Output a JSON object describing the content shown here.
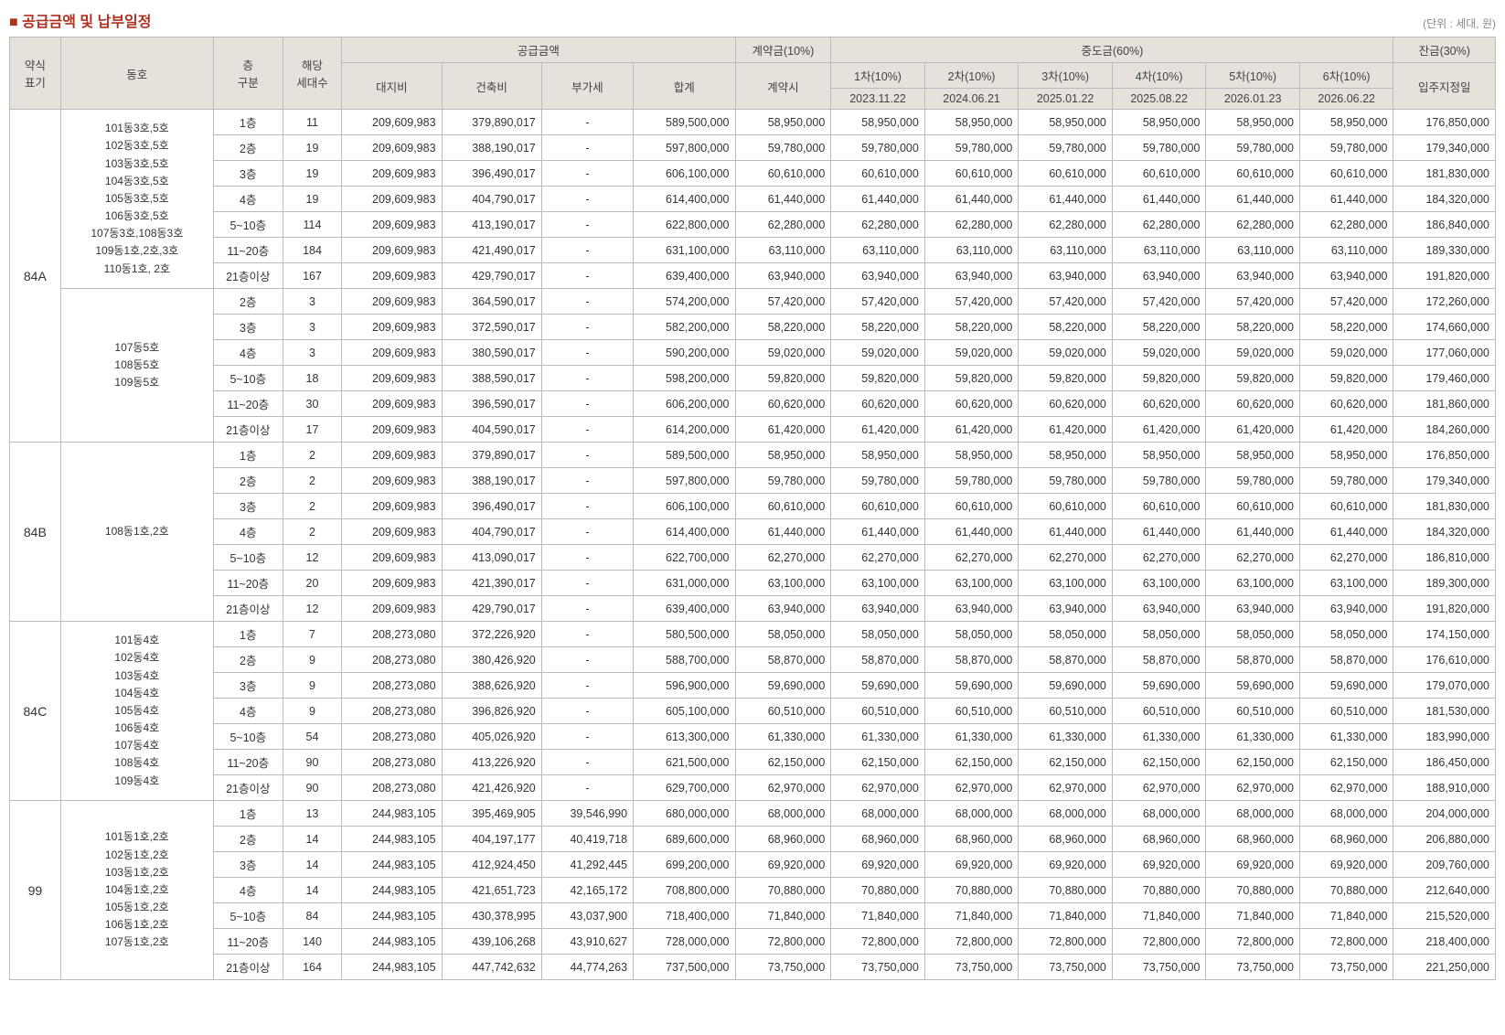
{
  "title": "공급금액 및 납부일정",
  "unit": "(단위 : 세대, 원)",
  "headers": {
    "type": "약식\n표기",
    "dongho": "동호",
    "floor": "층\n구분",
    "count": "해당\n세대수",
    "supply_group": "공급금액",
    "land": "대지비",
    "build": "건축비",
    "tax": "부가세",
    "sum": "합계",
    "deposit_group": "계약금(10%)",
    "deposit": "계약시",
    "mid_group": "중도금(60%)",
    "mid1": "1차(10%)",
    "mid1_date": "2023.11.22",
    "mid2": "2차(10%)",
    "mid2_date": "2024.06.21",
    "mid3": "3차(10%)",
    "mid3_date": "2025.01.22",
    "mid4": "4차(10%)",
    "mid4_date": "2025.08.22",
    "mid5": "5차(10%)",
    "mid5_date": "2026.01.23",
    "mid6": "6차(10%)",
    "mid6_date": "2026.06.22",
    "balance_group": "잔금(30%)",
    "balance": "입주지정일"
  },
  "groups": [
    {
      "type": "84A",
      "blocks": [
        {
          "dongho": "101동3호,5호\n102동3호,5호\n103동3호,5호\n104동3호,5호\n105동3호,5호\n106동3호,5호\n107동3호,108동3호\n109동1호,2호,3호\n110동1호, 2호",
          "rows": [
            {
              "floor": "1층",
              "count": "11",
              "land": "209,609,983",
              "build": "379,890,017",
              "tax": "-",
              "sum": "589,500,000",
              "dep": "58,950,000",
              "mid": "58,950,000",
              "bal": "176,850,000"
            },
            {
              "floor": "2층",
              "count": "19",
              "land": "209,609,983",
              "build": "388,190,017",
              "tax": "-",
              "sum": "597,800,000",
              "dep": "59,780,000",
              "mid": "59,780,000",
              "bal": "179,340,000"
            },
            {
              "floor": "3층",
              "count": "19",
              "land": "209,609,983",
              "build": "396,490,017",
              "tax": "-",
              "sum": "606,100,000",
              "dep": "60,610,000",
              "mid": "60,610,000",
              "bal": "181,830,000"
            },
            {
              "floor": "4층",
              "count": "19",
              "land": "209,609,983",
              "build": "404,790,017",
              "tax": "-",
              "sum": "614,400,000",
              "dep": "61,440,000",
              "mid": "61,440,000",
              "bal": "184,320,000"
            },
            {
              "floor": "5~10층",
              "count": "114",
              "land": "209,609,983",
              "build": "413,190,017",
              "tax": "-",
              "sum": "622,800,000",
              "dep": "62,280,000",
              "mid": "62,280,000",
              "bal": "186,840,000"
            },
            {
              "floor": "11~20층",
              "count": "184",
              "land": "209,609,983",
              "build": "421,490,017",
              "tax": "-",
              "sum": "631,100,000",
              "dep": "63,110,000",
              "mid": "63,110,000",
              "bal": "189,330,000"
            },
            {
              "floor": "21층이상",
              "count": "167",
              "land": "209,609,983",
              "build": "429,790,017",
              "tax": "-",
              "sum": "639,400,000",
              "dep": "63,940,000",
              "mid": "63,940,000",
              "bal": "191,820,000"
            }
          ]
        },
        {
          "dongho": "107동5호\n108동5호\n109동5호",
          "rows": [
            {
              "floor": "2층",
              "count": "3",
              "land": "209,609,983",
              "build": "364,590,017",
              "tax": "-",
              "sum": "574,200,000",
              "dep": "57,420,000",
              "mid": "57,420,000",
              "bal": "172,260,000"
            },
            {
              "floor": "3층",
              "count": "3",
              "land": "209,609,983",
              "build": "372,590,017",
              "tax": "-",
              "sum": "582,200,000",
              "dep": "58,220,000",
              "mid": "58,220,000",
              "bal": "174,660,000"
            },
            {
              "floor": "4층",
              "count": "3",
              "land": "209,609,983",
              "build": "380,590,017",
              "tax": "-",
              "sum": "590,200,000",
              "dep": "59,020,000",
              "mid": "59,020,000",
              "bal": "177,060,000"
            },
            {
              "floor": "5~10층",
              "count": "18",
              "land": "209,609,983",
              "build": "388,590,017",
              "tax": "-",
              "sum": "598,200,000",
              "dep": "59,820,000",
              "mid": "59,820,000",
              "bal": "179,460,000"
            },
            {
              "floor": "11~20층",
              "count": "30",
              "land": "209,609,983",
              "build": "396,590,017",
              "tax": "-",
              "sum": "606,200,000",
              "dep": "60,620,000",
              "mid": "60,620,000",
              "bal": "181,860,000"
            },
            {
              "floor": "21층이상",
              "count": "17",
              "land": "209,609,983",
              "build": "404,590,017",
              "tax": "-",
              "sum": "614,200,000",
              "dep": "61,420,000",
              "mid": "61,420,000",
              "bal": "184,260,000"
            }
          ]
        }
      ]
    },
    {
      "type": "84B",
      "blocks": [
        {
          "dongho": "108동1호,2호",
          "rows": [
            {
              "floor": "1층",
              "count": "2",
              "land": "209,609,983",
              "build": "379,890,017",
              "tax": "-",
              "sum": "589,500,000",
              "dep": "58,950,000",
              "mid": "58,950,000",
              "bal": "176,850,000"
            },
            {
              "floor": "2층",
              "count": "2",
              "land": "209,609,983",
              "build": "388,190,017",
              "tax": "-",
              "sum": "597,800,000",
              "dep": "59,780,000",
              "mid": "59,780,000",
              "bal": "179,340,000"
            },
            {
              "floor": "3층",
              "count": "2",
              "land": "209,609,983",
              "build": "396,490,017",
              "tax": "-",
              "sum": "606,100,000",
              "dep": "60,610,000",
              "mid": "60,610,000",
              "bal": "181,830,000"
            },
            {
              "floor": "4층",
              "count": "2",
              "land": "209,609,983",
              "build": "404,790,017",
              "tax": "-",
              "sum": "614,400,000",
              "dep": "61,440,000",
              "mid": "61,440,000",
              "bal": "184,320,000"
            },
            {
              "floor": "5~10층",
              "count": "12",
              "land": "209,609,983",
              "build": "413,090,017",
              "tax": "-",
              "sum": "622,700,000",
              "dep": "62,270,000",
              "mid": "62,270,000",
              "bal": "186,810,000"
            },
            {
              "floor": "11~20층",
              "count": "20",
              "land": "209,609,983",
              "build": "421,390,017",
              "tax": "-",
              "sum": "631,000,000",
              "dep": "63,100,000",
              "mid": "63,100,000",
              "bal": "189,300,000"
            },
            {
              "floor": "21층이상",
              "count": "12",
              "land": "209,609,983",
              "build": "429,790,017",
              "tax": "-",
              "sum": "639,400,000",
              "dep": "63,940,000",
              "mid": "63,940,000",
              "bal": "191,820,000"
            }
          ]
        }
      ]
    },
    {
      "type": "84C",
      "blocks": [
        {
          "dongho": "101동4호\n102동4호\n103동4호\n104동4호\n105동4호\n106동4호\n107동4호\n108동4호\n109동4호",
          "rows": [
            {
              "floor": "1층",
              "count": "7",
              "land": "208,273,080",
              "build": "372,226,920",
              "tax": "-",
              "sum": "580,500,000",
              "dep": "58,050,000",
              "mid": "58,050,000",
              "bal": "174,150,000"
            },
            {
              "floor": "2층",
              "count": "9",
              "land": "208,273,080",
              "build": "380,426,920",
              "tax": "-",
              "sum": "588,700,000",
              "dep": "58,870,000",
              "mid": "58,870,000",
              "bal": "176,610,000"
            },
            {
              "floor": "3층",
              "count": "9",
              "land": "208,273,080",
              "build": "388,626,920",
              "tax": "-",
              "sum": "596,900,000",
              "dep": "59,690,000",
              "mid": "59,690,000",
              "bal": "179,070,000"
            },
            {
              "floor": "4층",
              "count": "9",
              "land": "208,273,080",
              "build": "396,826,920",
              "tax": "-",
              "sum": "605,100,000",
              "dep": "60,510,000",
              "mid": "60,510,000",
              "bal": "181,530,000"
            },
            {
              "floor": "5~10층",
              "count": "54",
              "land": "208,273,080",
              "build": "405,026,920",
              "tax": "-",
              "sum": "613,300,000",
              "dep": "61,330,000",
              "mid": "61,330,000",
              "bal": "183,990,000"
            },
            {
              "floor": "11~20층",
              "count": "90",
              "land": "208,273,080",
              "build": "413,226,920",
              "tax": "-",
              "sum": "621,500,000",
              "dep": "62,150,000",
              "mid": "62,150,000",
              "bal": "186,450,000"
            },
            {
              "floor": "21층이상",
              "count": "90",
              "land": "208,273,080",
              "build": "421,426,920",
              "tax": "-",
              "sum": "629,700,000",
              "dep": "62,970,000",
              "mid": "62,970,000",
              "bal": "188,910,000"
            }
          ]
        }
      ]
    },
    {
      "type": "99",
      "blocks": [
        {
          "dongho": "101동1호,2호\n102동1호,2호\n103동1호,2호\n104동1호,2호\n105동1호,2호\n106동1호,2호\n107동1호,2호",
          "rows": [
            {
              "floor": "1층",
              "count": "13",
              "land": "244,983,105",
              "build": "395,469,905",
              "tax": "39,546,990",
              "sum": "680,000,000",
              "dep": "68,000,000",
              "mid": "68,000,000",
              "bal": "204,000,000"
            },
            {
              "floor": "2층",
              "count": "14",
              "land": "244,983,105",
              "build": "404,197,177",
              "tax": "40,419,718",
              "sum": "689,600,000",
              "dep": "68,960,000",
              "mid": "68,960,000",
              "bal": "206,880,000"
            },
            {
              "floor": "3층",
              "count": "14",
              "land": "244,983,105",
              "build": "412,924,450",
              "tax": "41,292,445",
              "sum": "699,200,000",
              "dep": "69,920,000",
              "mid": "69,920,000",
              "bal": "209,760,000"
            },
            {
              "floor": "4층",
              "count": "14",
              "land": "244,983,105",
              "build": "421,651,723",
              "tax": "42,165,172",
              "sum": "708,800,000",
              "dep": "70,880,000",
              "mid": "70,880,000",
              "bal": "212,640,000"
            },
            {
              "floor": "5~10층",
              "count": "84",
              "land": "244,983,105",
              "build": "430,378,995",
              "tax": "43,037,900",
              "sum": "718,400,000",
              "dep": "71,840,000",
              "mid": "71,840,000",
              "bal": "215,520,000"
            },
            {
              "floor": "11~20층",
              "count": "140",
              "land": "244,983,105",
              "build": "439,106,268",
              "tax": "43,910,627",
              "sum": "728,000,000",
              "dep": "72,800,000",
              "mid": "72,800,000",
              "bal": "218,400,000"
            },
            {
              "floor": "21층이상",
              "count": "164",
              "land": "244,983,105",
              "build": "447,742,632",
              "tax": "44,774,263",
              "sum": "737,500,000",
              "dep": "73,750,000",
              "mid": "73,750,000",
              "bal": "221,250,000"
            }
          ]
        }
      ]
    }
  ]
}
